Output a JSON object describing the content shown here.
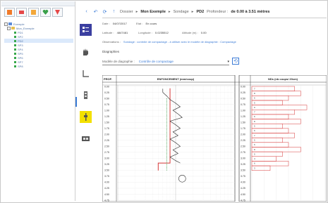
{
  "tree": {
    "root": "Exemple",
    "project": "Mon_Exemple",
    "items": [
      "PD1",
      "SP2",
      "PD2",
      "SP3",
      "SP4",
      "SP5",
      "SP6",
      "SP7",
      "SP8"
    ],
    "selected_index": 2
  },
  "nav": {
    "section": "Dossier",
    "arrow1": "▸",
    "project": "Mon Exemple",
    "arrow2": "▸",
    "type": "Sondage",
    "arrow3": "▸",
    "code": "PD2",
    "depth_label": "Profondeur :",
    "depth_value": "de 0.00 à 3.51 mètres"
  },
  "fields": {
    "date_label": "Date :",
    "date_value": "04/07/2017",
    "etat_label": "Etat :",
    "etat_value": "En cours",
    "lat_label": "Latitude :",
    "lat_value": "4847481",
    "long_label": "Longitude :",
    "long_value": "0.0235512",
    "alt_label": "Altitude (m) :",
    "alt_value": "0.00",
    "obs_label": "Observations :",
    "obs_value": "Sondage : contrôle de compactage - à utiliser avec le modèle de diagraphie : Compactage"
  },
  "diagraphies": {
    "label": "Diagraphies",
    "model_label": "Modèle de diagraphie :",
    "model_value": "Contrôle de compactage"
  },
  "chart_data": [
    {
      "type": "line",
      "title": "ENFONCEMENT (mm/coup)",
      "ylabel": "PROF.",
      "ylim": [
        0,
        4.75
      ],
      "x": [
        6,
        6,
        7,
        8,
        10,
        12,
        9,
        11,
        13,
        8,
        10,
        12,
        9,
        11,
        8,
        10,
        12,
        9,
        11,
        8,
        10,
        12
      ],
      "y": [
        0.1,
        0.25,
        0.4,
        0.55,
        0.7,
        0.85,
        1.0,
        1.15,
        1.3,
        1.45,
        1.6,
        1.75,
        1.9,
        2.05,
        2.2,
        2.35,
        2.5,
        2.65,
        2.8,
        2.95,
        3.1,
        3.2
      ]
    },
    {
      "type": "bar",
      "title": "NDs (nb coups/ 20cm)",
      "depth_ticks": [
        "0.00",
        "0.25",
        "0.50",
        "0.75",
        "1.00",
        "1.25",
        "1.50",
        "1.75",
        "2.00",
        "2.25",
        "2.50",
        "2.75",
        "3.00",
        "3.25",
        "3.50",
        "3.75",
        "4.00",
        "4.25",
        "4.50",
        "4.75"
      ],
      "values": [
        7,
        8,
        6,
        5,
        9,
        7,
        6,
        8,
        5,
        6,
        7,
        5,
        6,
        8,
        5,
        4,
        6,
        3
      ]
    }
  ]
}
